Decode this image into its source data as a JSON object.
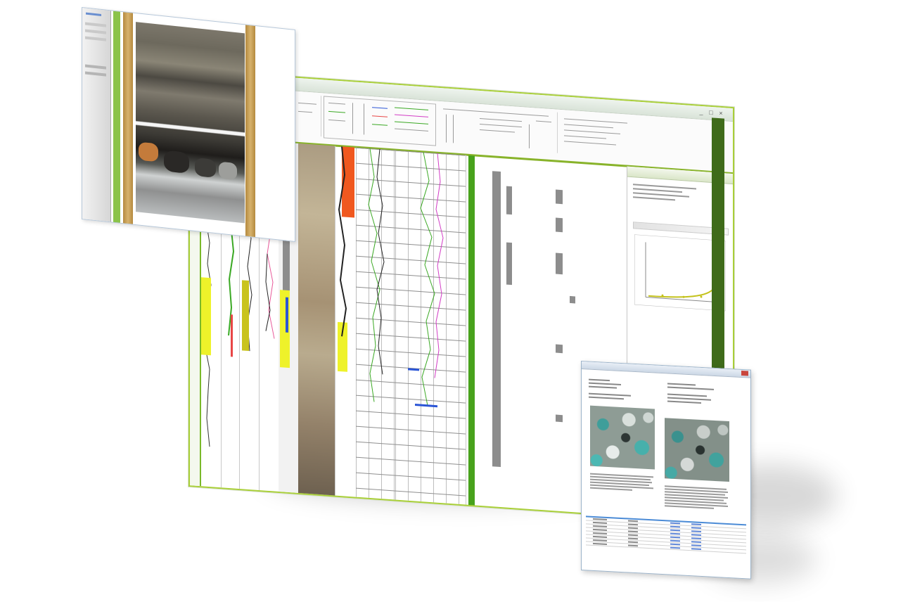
{
  "window_controls": [
    "_",
    "□",
    "×"
  ],
  "curve_colors": {
    "green": "#3aa823",
    "orange": "#f0581f",
    "yellow": "#eef22a",
    "magenta": "#d23cc5",
    "blue": "#2b55d6",
    "pink": "#e85a9a",
    "brand_green": "#88b32a"
  }
}
